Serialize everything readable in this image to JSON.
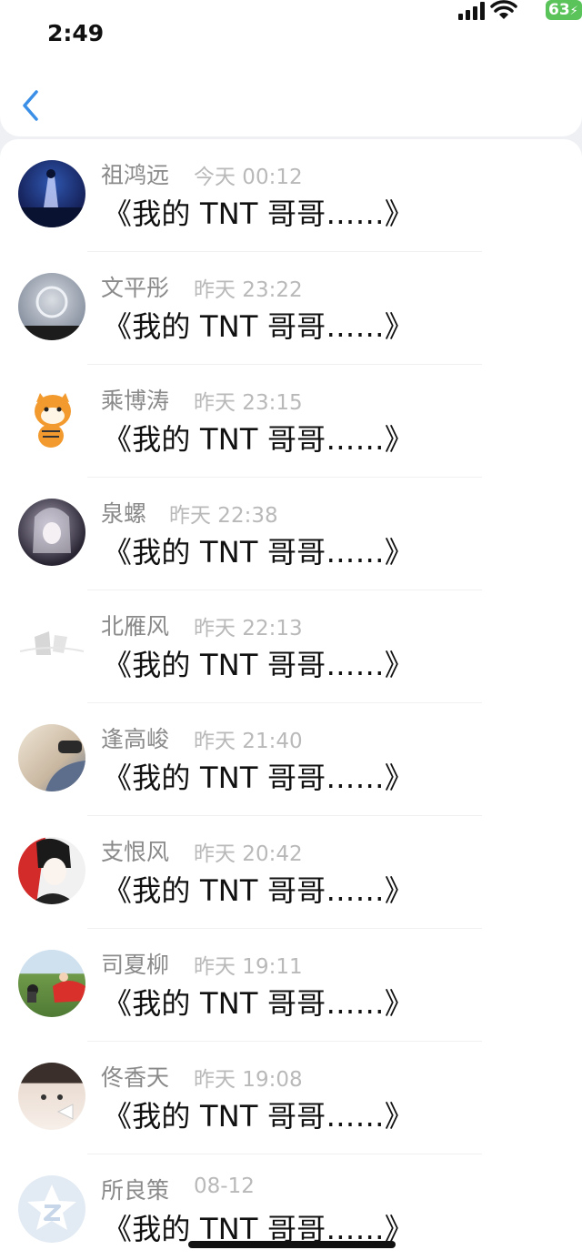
{
  "status": {
    "time": "2:49",
    "battery": "63"
  },
  "messages": [
    {
      "name": "祖鸿远",
      "time": "今天 00:12",
      "text": "《我的 TNT 哥哥……》"
    },
    {
      "name": "文平彤",
      "time": "昨天 23:22",
      "text": "《我的 TNT 哥哥……》"
    },
    {
      "name": "乘博涛",
      "time": "昨天 23:15",
      "text": "《我的 TNT 哥哥……》"
    },
    {
      "name": "泉螺",
      "time": "昨天 22:38",
      "text": "《我的 TNT 哥哥……》"
    },
    {
      "name": "北雁风",
      "time": "昨天 22:13",
      "text": "《我的 TNT 哥哥……》"
    },
    {
      "name": "逢高峻",
      "time": "昨天 21:40",
      "text": "《我的 TNT 哥哥……》"
    },
    {
      "name": "支恨风",
      "time": "昨天 20:42",
      "text": "《我的 TNT 哥哥……》"
    },
    {
      "name": "司夏柳",
      "time": "昨天 19:11",
      "text": "《我的 TNT 哥哥……》"
    },
    {
      "name": "佟香天",
      "time": "昨天 19:08",
      "text": "《我的 TNT 哥哥……》"
    },
    {
      "name": "所良策",
      "time": "08-12",
      "text": "《我的 TNT 哥哥……》"
    }
  ]
}
